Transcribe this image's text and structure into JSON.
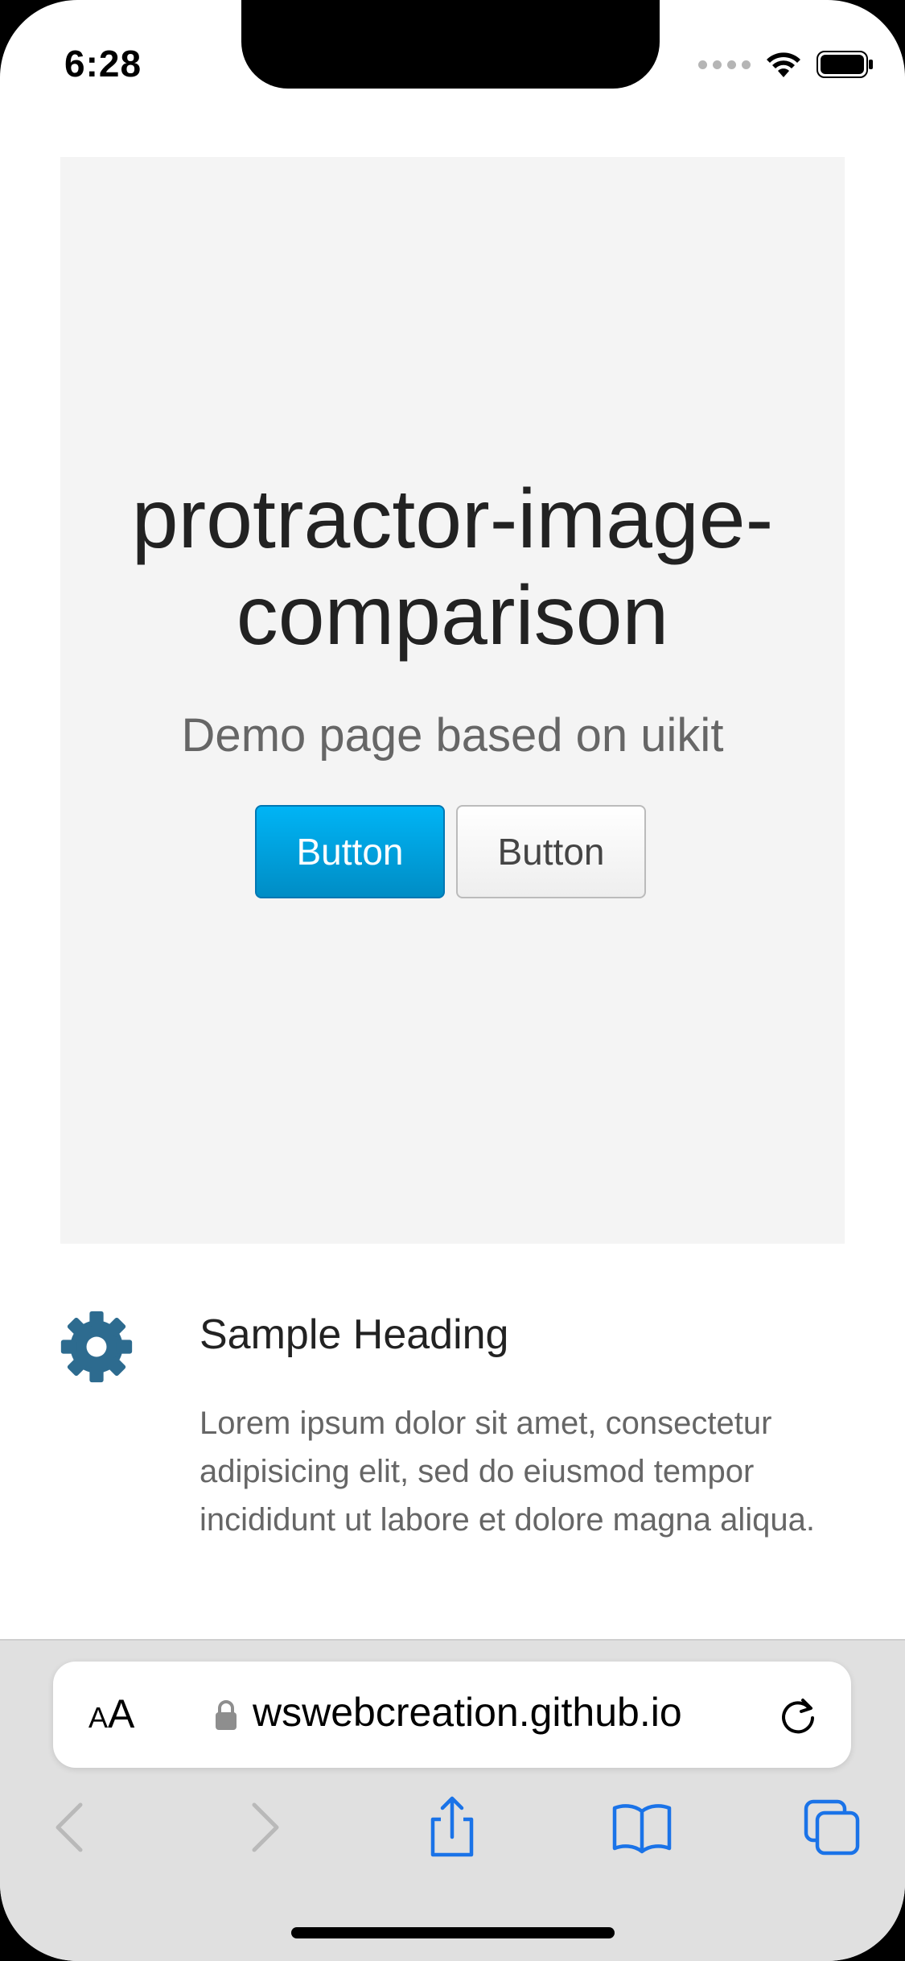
{
  "status_bar": {
    "time": "6:28"
  },
  "hero": {
    "title_line1": "protractor-image-",
    "title_line2": "comparison",
    "subtitle": "Demo page based on uikit",
    "primary_button": "Button",
    "secondary_button": "Button"
  },
  "feature": {
    "icon": "gear-icon",
    "heading": "Sample Heading",
    "text": "Lorem ipsum dolor sit amet, consectetur adipisicing elit, sed do eiusmod tempor incididunt ut labore et dolore magna aliqua."
  },
  "browser": {
    "aa_small": "A",
    "aa_large": "A",
    "url": "wswebcreation.github.io"
  },
  "colors": {
    "primary": "#009dd8",
    "icon_blue": "#2d6b8f",
    "toolbar_blue": "#1a73e8"
  }
}
